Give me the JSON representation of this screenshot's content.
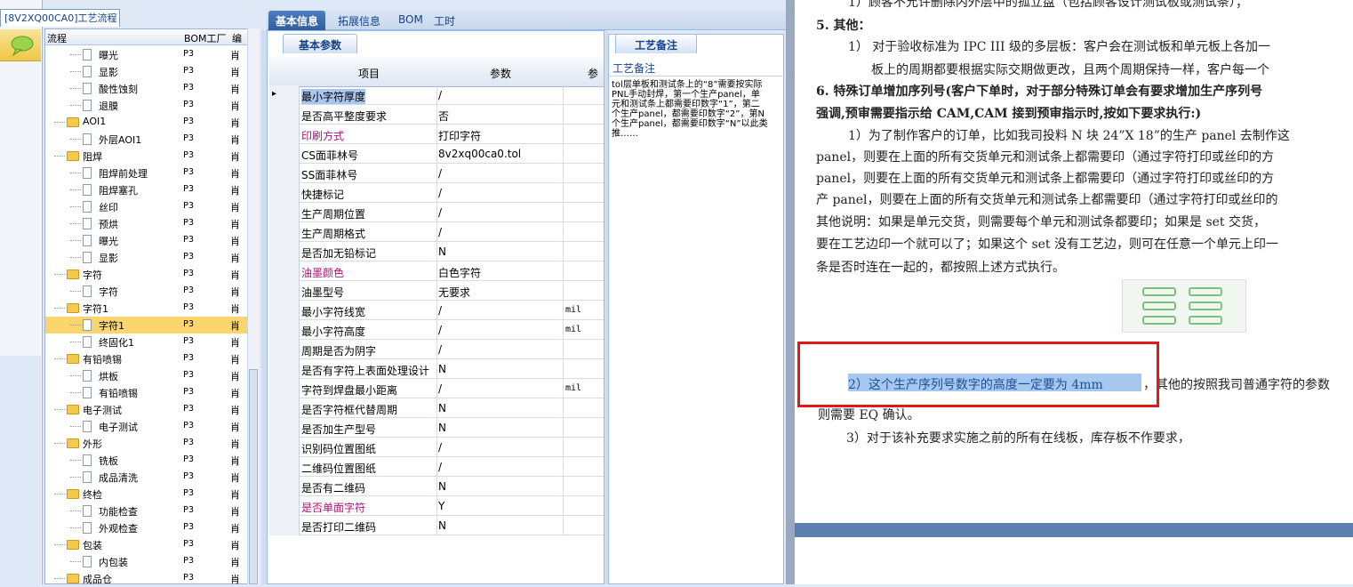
{
  "window": {
    "tree_title": "[8V2XQ00CA0]工艺流程"
  },
  "tree": {
    "headers": [
      "流程",
      "BOM工厂",
      "编"
    ],
    "rows": [
      {
        "level": 3,
        "label": "曝光",
        "type": "doc",
        "bom": "P3",
        "ed": "肖"
      },
      {
        "level": 3,
        "label": "显影",
        "type": "doc",
        "bom": "P3",
        "ed": "肖"
      },
      {
        "level": 3,
        "label": "酸性蚀刻",
        "type": "doc",
        "bom": "P3",
        "ed": "肖"
      },
      {
        "level": 3,
        "label": "退膜",
        "type": "doc",
        "bom": "P3",
        "ed": "肖"
      },
      {
        "level": 2,
        "label": "AOI1",
        "type": "folder",
        "bom": "P3",
        "ed": "肖"
      },
      {
        "level": 3,
        "label": "外层AOI1",
        "type": "doc",
        "bom": "P3",
        "ed": "肖"
      },
      {
        "level": 2,
        "label": "阻焊",
        "type": "folder",
        "bom": "P3",
        "ed": "肖"
      },
      {
        "level": 3,
        "label": "阻焊前处理",
        "type": "doc",
        "bom": "P3",
        "ed": "肖"
      },
      {
        "level": 3,
        "label": "阻焊塞孔",
        "type": "doc",
        "bom": "P3",
        "ed": "肖"
      },
      {
        "level": 3,
        "label": "丝印",
        "type": "doc",
        "bom": "P3",
        "ed": "肖"
      },
      {
        "level": 3,
        "label": "预烘",
        "type": "doc",
        "bom": "P3",
        "ed": "肖"
      },
      {
        "level": 3,
        "label": "曝光",
        "type": "doc",
        "bom": "P3",
        "ed": "肖"
      },
      {
        "level": 3,
        "label": "显影",
        "type": "doc",
        "bom": "P3",
        "ed": "肖"
      },
      {
        "level": 2,
        "label": "字符",
        "type": "folder",
        "bom": "P3",
        "ed": "肖"
      },
      {
        "level": 3,
        "label": "字符",
        "type": "doc",
        "bom": "P3",
        "ed": "肖"
      },
      {
        "level": 2,
        "label": "字符1",
        "type": "folder",
        "bom": "P3",
        "ed": "肖"
      },
      {
        "level": 3,
        "label": "字符1",
        "type": "doc",
        "bom": "P3",
        "ed": "肖",
        "selected": true
      },
      {
        "level": 3,
        "label": "终固化1",
        "type": "doc",
        "bom": "P3",
        "ed": "肖"
      },
      {
        "level": 2,
        "label": "有铅喷锡",
        "type": "folder",
        "bom": "P3",
        "ed": "肖"
      },
      {
        "level": 3,
        "label": "烘板",
        "type": "doc",
        "bom": "P3",
        "ed": "肖"
      },
      {
        "level": 3,
        "label": "有铅喷锡",
        "type": "doc",
        "bom": "P3",
        "ed": "肖"
      },
      {
        "level": 2,
        "label": "电子测试",
        "type": "folder",
        "bom": "P3",
        "ed": "肖"
      },
      {
        "level": 3,
        "label": "电子测试",
        "type": "doc",
        "bom": "P3",
        "ed": "肖"
      },
      {
        "level": 2,
        "label": "外形",
        "type": "folder",
        "bom": "P3",
        "ed": "肖"
      },
      {
        "level": 3,
        "label": "铣板",
        "type": "doc",
        "bom": "P3",
        "ed": "肖"
      },
      {
        "level": 3,
        "label": "成品清洗",
        "type": "doc",
        "bom": "P3",
        "ed": "肖"
      },
      {
        "level": 2,
        "label": "终检",
        "type": "folder",
        "bom": "P3",
        "ed": "肖"
      },
      {
        "level": 3,
        "label": "功能检查",
        "type": "doc",
        "bom": "P3",
        "ed": "肖"
      },
      {
        "level": 3,
        "label": "外观检查",
        "type": "doc",
        "bom": "P3",
        "ed": "肖"
      },
      {
        "level": 2,
        "label": "包装",
        "type": "folder",
        "bom": "P3",
        "ed": "肖"
      },
      {
        "level": 3,
        "label": "内包装",
        "type": "doc",
        "bom": "P3",
        "ed": "肖"
      },
      {
        "level": 2,
        "label": "成品仓",
        "type": "folder",
        "bom": "P3",
        "ed": "肖"
      }
    ]
  },
  "top_tabs": [
    "基本信息",
    "拓展信息",
    "BOM",
    "工时"
  ],
  "sub_tab": "基本参数",
  "grid": {
    "headers": [
      "项目",
      "参数",
      "参"
    ],
    "rows": [
      {
        "k": "最小字符厚度",
        "v": "/",
        "u": "",
        "current": true
      },
      {
        "k": "是否高平整度要求",
        "v": "否",
        "u": ""
      },
      {
        "k": "印刷方式",
        "v": "打印字符",
        "u": "",
        "mag": true
      },
      {
        "k": "CS面菲林号",
        "v": "8v2xq00ca0.tol",
        "u": ""
      },
      {
        "k": "SS面菲林号",
        "v": "/",
        "u": ""
      },
      {
        "k": "快捷标记",
        "v": "/",
        "u": ""
      },
      {
        "k": "生产周期位置",
        "v": "/",
        "u": ""
      },
      {
        "k": "生产周期格式",
        "v": "/",
        "u": ""
      },
      {
        "k": "是否加无铅标记",
        "v": "N",
        "u": ""
      },
      {
        "k": "油墨颜色",
        "v": "白色字符",
        "u": "",
        "mag": true
      },
      {
        "k": "油墨型号",
        "v": "无要求",
        "u": ""
      },
      {
        "k": "最小字符线宽",
        "v": "/",
        "u": "mil"
      },
      {
        "k": "最小字符高度",
        "v": "/",
        "u": "mil"
      },
      {
        "k": "周期是否为阴字",
        "v": "/",
        "u": ""
      },
      {
        "k": "是否有字符上表面处理设计",
        "v": "N",
        "u": ""
      },
      {
        "k": "字符到焊盘最小距离",
        "v": "/",
        "u": "mil"
      },
      {
        "k": "是否字符框代替周期",
        "v": "N",
        "u": ""
      },
      {
        "k": "是否加生产型号",
        "v": "N",
        "u": ""
      },
      {
        "k": "识别码位置图纸",
        "v": "/",
        "u": ""
      },
      {
        "k": "二维码位置图纸",
        "v": "/",
        "u": ""
      },
      {
        "k": "是否有二维码",
        "v": "N",
        "u": ""
      },
      {
        "k": "是否单面字符",
        "v": "Y",
        "u": "",
        "mag": true
      },
      {
        "k": "是否打印二维码",
        "v": "N",
        "u": ""
      }
    ]
  },
  "note": {
    "tab": "工艺备注",
    "header": "工艺备注",
    "text": "tol层单板和测试条上的“8”需要按实际PNL手动封焊，第一个生产panel，单元和测试条上都需要印数字“1”，第二个生产panel，都需要印数字“2”，第N个生产panel，都需要印数字“N”以此类推……"
  },
  "document": {
    "lines": [
      "1）顾客不允许删除内外层中的孤立盘（包括顾客设计测试板或测试条）；",
      "5.   其他：",
      "1） 对于验收标准为 IPC III 级的多层板：客户会在测试板和单元板上各加一",
      "板上的周期都要根据实际交期做更改，且两个周期保持一样，客户每一个",
      "6. 特殊订单增加序列号(客户下单时，对于部分特殊订单会有要求增加生产序列号",
      "强调,预审需要指示给 CAM,CAM 接到预审指示时,按如下要求执行:)",
      "1）为了制作客户的订单，比如我司投料 N 块 24”X 18”的生产 panel 去制作这",
      "panel，则要在上面的所有交货单元和测试条上都需要印（通过字符打印或丝印的方",
      "panel，则要在上面的所有交货单元和测试条上都需要印（通过字符打印或丝印的方",
      "产 panel，则要在上面的所有交货单元和测试条上都需要印（通过字符打印或丝印的",
      "其他说明：如果是单元交货，则需要每个单元和测试条都要印；如果是 set 交货，",
      "要在工艺边印一个就可以了；如果这个 set 没有工艺边，则可在任意一个单元上印一",
      "条是否时连在一起的，都按照上述方式执行。",
      "2）这个生产序列号数字的高度一定要为 4mm",
      "，其他的按照我司普通字符的参数",
      "则需要 EQ 确认。",
      "3）对于该补充要求实施之前的所有在线板，库存板不作要求，"
    ]
  }
}
